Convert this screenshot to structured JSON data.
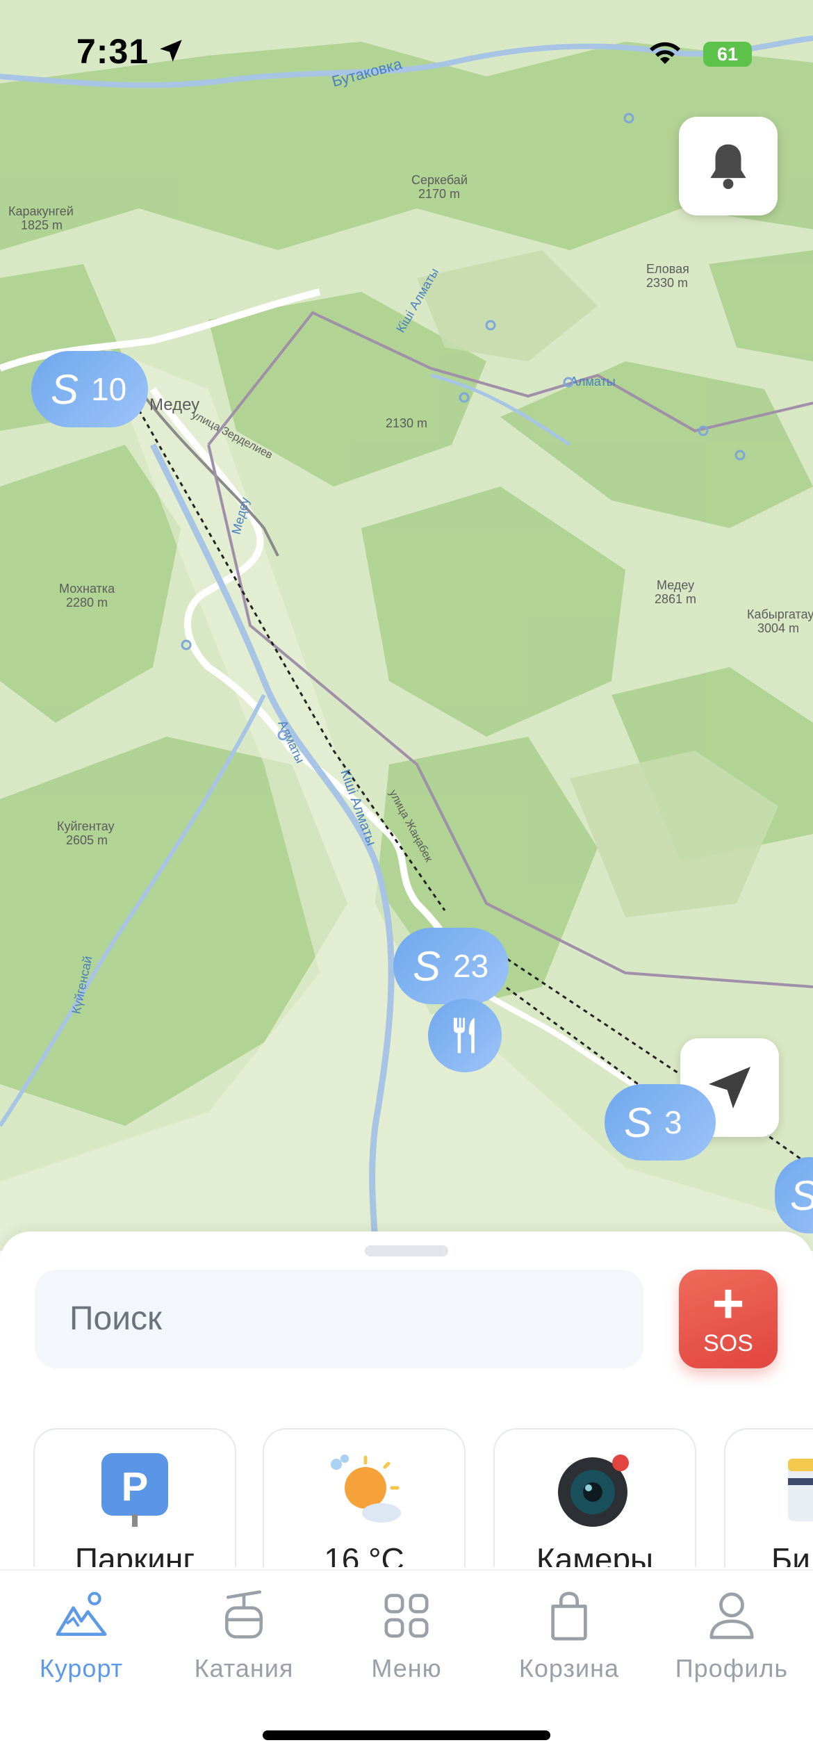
{
  "status_bar": {
    "time": "7:31",
    "battery": "61"
  },
  "map": {
    "labels": [
      {
        "text": "Бутаковка"
      },
      {
        "text": "Каракунгей"
      },
      {
        "text": "1825 m"
      },
      {
        "text": "Серкебай"
      },
      {
        "text": "2170 m"
      },
      {
        "text": "Еловая"
      },
      {
        "text": "2330 m"
      },
      {
        "text": "Медеу"
      },
      {
        "text": "2130 m"
      },
      {
        "text": "Алматы"
      },
      {
        "text": "Медеу"
      },
      {
        "text": "2861 m"
      },
      {
        "text": "Кабыргатау"
      },
      {
        "text": "3004 m"
      },
      {
        "text": "Мохнатка"
      },
      {
        "text": "2280 m"
      },
      {
        "text": "Куйгентау"
      },
      {
        "text": "2605 m"
      },
      {
        "text": "Кіші Алматы"
      },
      {
        "text": "Алматы"
      },
      {
        "text": "улица Зерделиев"
      },
      {
        "text": "Медеу"
      },
      {
        "text": "Күйгенсай"
      },
      {
        "text": "Кіші Алматы"
      },
      {
        "text": "улица Жаңабек"
      }
    ],
    "clusters": [
      {
        "count": "10",
        "icon": "ski-lift-icon"
      },
      {
        "count": "23",
        "icon": "ski-lift-icon"
      },
      {
        "count": "3",
        "icon": "ski-lift-icon"
      }
    ],
    "restaurant_pin": {
      "icon": "fork-knife-icon"
    },
    "notifications_button": {
      "icon": "bell-icon"
    },
    "locate_button": {
      "icon": "location-arrow-icon"
    }
  },
  "sheet": {
    "search": {
      "placeholder": "Поиск"
    },
    "sos_label": "SOS",
    "cards": [
      {
        "label": "Паркинг",
        "icon": "parking-icon"
      },
      {
        "label": "16 °C",
        "icon": "weather-icon"
      },
      {
        "label": "Камеры",
        "icon": "camera-icon"
      },
      {
        "label": "Билеты",
        "icon": "ticket-icon"
      }
    ]
  },
  "tabbar": {
    "tabs": [
      {
        "label": "Курорт",
        "icon": "mountains-icon",
        "active": true
      },
      {
        "label": "Катания",
        "icon": "cable-car-icon",
        "active": false
      },
      {
        "label": "Меню",
        "icon": "grid-icon",
        "active": false
      },
      {
        "label": "Корзина",
        "icon": "bag-icon",
        "active": false
      },
      {
        "label": "Профиль",
        "icon": "profile-icon",
        "active": false
      }
    ]
  },
  "colors": {
    "accent": "#5c9ae8",
    "sos": "#e2453f",
    "map_green": "#cfe3b4",
    "map_dark_green": "#8fbf6e",
    "tab_inactive": "#9aa0a8"
  }
}
